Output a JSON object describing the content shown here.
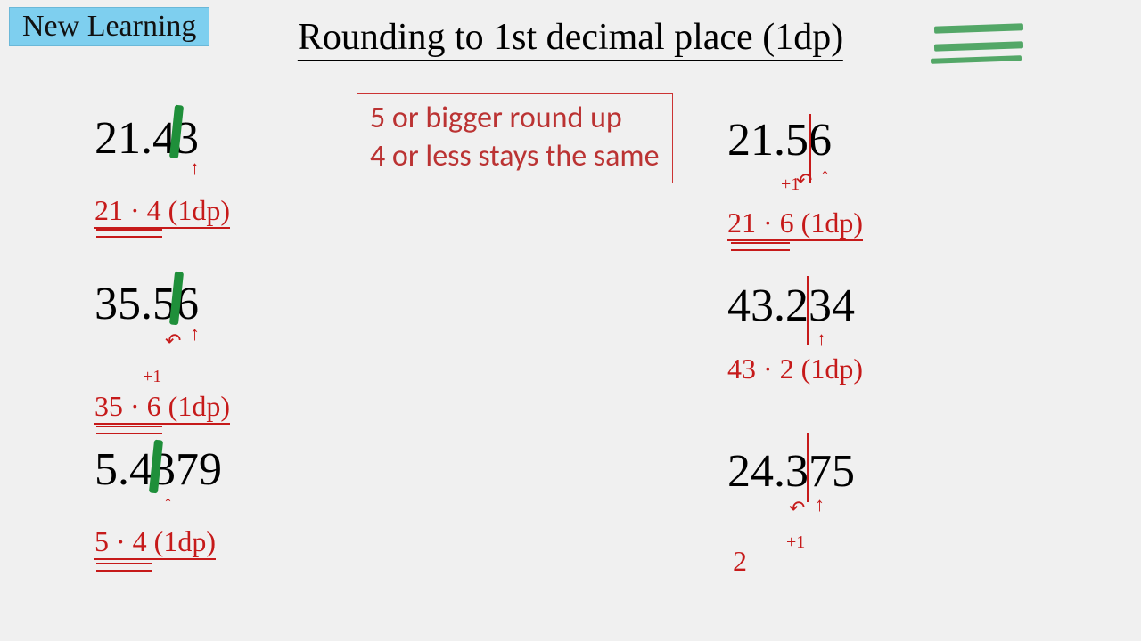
{
  "badge": "New Learning",
  "title": "Rounding to 1st decimal place (1dp)",
  "rules": {
    "line1": "5 or bigger round up",
    "line2": "4 or less stays the same"
  },
  "left": {
    "n1": "21.43",
    "a1": "21 · 4  (1dp)",
    "n2": "35.56",
    "a2": "35 · 6  (1dp)",
    "n3": "5.4379",
    "a3": "5 · 4   (1dp)"
  },
  "right": {
    "n1": "21.56",
    "a1": "21 · 6   (1dp)",
    "n2": "43.234",
    "a2": "43 · 2    (1dp)",
    "n3": "24.375",
    "a3": "2"
  },
  "plus1": "+1"
}
